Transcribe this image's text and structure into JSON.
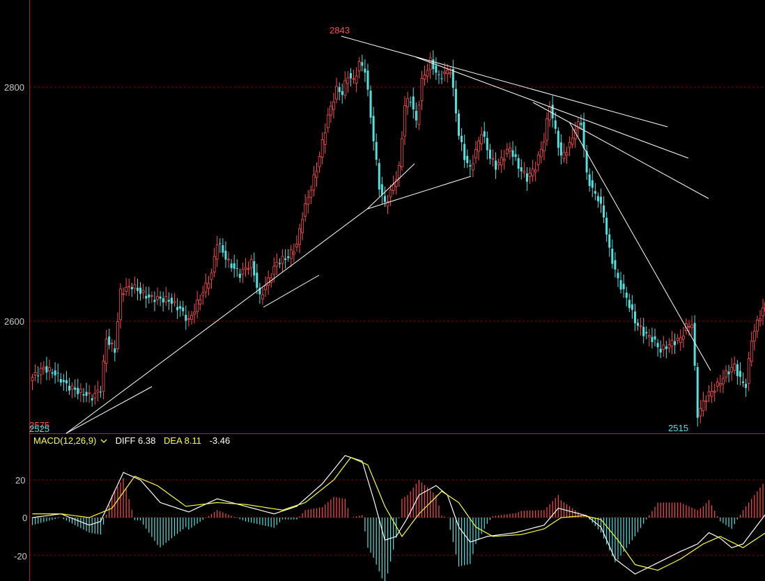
{
  "colors": {
    "background": "#000000",
    "up": "#ff4d4d",
    "down": "#4fe3e3",
    "grid": "#8b0000",
    "axis": "#b22222",
    "diff_line": "#ffffff",
    "dea_line": "#ffff33",
    "trendline": "#ffffff"
  },
  "price_panel": {
    "y_ticks": [
      "2800",
      "2600"
    ],
    "y_values": [
      2800,
      2600
    ],
    "ylim": [
      2510,
      2850
    ],
    "high_label": "2843",
    "low_label": "2515",
    "left_low_label": "2525",
    "left_overlap_label": "2575"
  },
  "macd_panel": {
    "legend": {
      "name": "MACD(12,26,9)",
      "dropdown_icon": "chevron-down-icon",
      "diff": "DIFF 6.38",
      "dea": "DEA 8.11",
      "macd": "-3.46"
    },
    "y_ticks": [
      "20",
      "0",
      "-20"
    ],
    "y_values": [
      20,
      0,
      -20
    ],
    "ylim": [
      -32,
      36
    ]
  },
  "chart_data": [
    {
      "type": "candlestick",
      "ylim": [
        2510,
        2850
      ],
      "close_anchors": [
        [
          0,
          2552
        ],
        [
          4,
          2560
        ],
        [
          8,
          2555
        ],
        [
          12,
          2545
        ],
        [
          16,
          2540
        ],
        [
          21,
          2535
        ],
        [
          24,
          2542
        ],
        [
          26,
          2585
        ],
        [
          29,
          2575
        ],
        [
          31,
          2625
        ],
        [
          35,
          2630
        ],
        [
          41,
          2620
        ],
        [
          48,
          2618
        ],
        [
          52,
          2610
        ],
        [
          55,
          2600
        ],
        [
          58,
          2615
        ],
        [
          63,
          2640
        ],
        [
          65,
          2668
        ],
        [
          69,
          2650
        ],
        [
          73,
          2640
        ],
        [
          77,
          2650
        ],
        [
          80,
          2620
        ],
        [
          83,
          2635
        ],
        [
          86,
          2650
        ],
        [
          90,
          2655
        ],
        [
          93,
          2665
        ],
        [
          95,
          2690
        ],
        [
          100,
          2730
        ],
        [
          104,
          2775
        ],
        [
          107,
          2798
        ],
        [
          109,
          2795
        ],
        [
          111,
          2810
        ],
        [
          113,
          2805
        ],
        [
          115,
          2820
        ],
        [
          117,
          2815
        ],
        [
          120,
          2755
        ],
        [
          122,
          2715
        ],
        [
          124,
          2700
        ],
        [
          126,
          2710
        ],
        [
          129,
          2730
        ],
        [
          131,
          2785
        ],
        [
          133,
          2790
        ],
        [
          135,
          2770
        ],
        [
          137,
          2805
        ],
        [
          140,
          2822
        ],
        [
          143,
          2808
        ],
        [
          147,
          2815
        ],
        [
          150,
          2760
        ],
        [
          152,
          2740
        ],
        [
          154,
          2730
        ],
        [
          156,
          2745
        ],
        [
          158,
          2762
        ],
        [
          161,
          2740
        ],
        [
          163,
          2732
        ],
        [
          165,
          2738
        ],
        [
          168,
          2748
        ],
        [
          171,
          2732
        ],
        [
          174,
          2722
        ],
        [
          177,
          2732
        ],
        [
          180,
          2755
        ],
        [
          182,
          2785
        ],
        [
          184,
          2762
        ],
        [
          186,
          2740
        ],
        [
          189,
          2750
        ],
        [
          191,
          2765
        ],
        [
          193,
          2770
        ],
        [
          195,
          2725
        ],
        [
          197,
          2712
        ],
        [
          199,
          2705
        ],
        [
          201,
          2690
        ],
        [
          203,
          2660
        ],
        [
          206,
          2635
        ],
        [
          209,
          2620
        ],
        [
          212,
          2600
        ],
        [
          215,
          2590
        ],
        [
          218,
          2585
        ],
        [
          221,
          2575
        ],
        [
          224,
          2580
        ],
        [
          228,
          2585
        ],
        [
          230,
          2595
        ],
        [
          232,
          2598
        ],
        [
          234,
          2520
        ],
        [
          237,
          2535
        ],
        [
          241,
          2545
        ],
        [
          244,
          2555
        ],
        [
          247,
          2562
        ],
        [
          249,
          2550
        ],
        [
          251,
          2545
        ],
        [
          253,
          2585
        ],
        [
          256,
          2605
        ],
        [
          259,
          2620
        ],
        [
          262,
          2610
        ],
        [
          264,
          2632
        ],
        [
          266,
          2622
        ]
      ]
    },
    {
      "type": "line",
      "name": "DIFF",
      "anchors": [
        [
          0,
          0
        ],
        [
          10,
          2
        ],
        [
          20,
          -4
        ],
        [
          24,
          -2
        ],
        [
          32,
          24
        ],
        [
          38,
          20
        ],
        [
          45,
          8
        ],
        [
          55,
          3
        ],
        [
          65,
          10
        ],
        [
          75,
          6
        ],
        [
          85,
          2
        ],
        [
          93,
          6
        ],
        [
          102,
          18
        ],
        [
          110,
          33
        ],
        [
          116,
          30
        ],
        [
          120,
          10
        ],
        [
          124,
          -12
        ],
        [
          128,
          -10
        ],
        [
          132,
          0
        ],
        [
          136,
          12
        ],
        [
          142,
          17
        ],
        [
          146,
          12
        ],
        [
          150,
          -5
        ],
        [
          154,
          -13
        ],
        [
          160,
          -10
        ],
        [
          170,
          -8
        ],
        [
          180,
          -4
        ],
        [
          185,
          5
        ],
        [
          190,
          3
        ],
        [
          195,
          1
        ],
        [
          200,
          -5
        ],
        [
          205,
          -22
        ],
        [
          212,
          -30
        ],
        [
          220,
          -24
        ],
        [
          228,
          -18
        ],
        [
          234,
          -14
        ],
        [
          238,
          -8
        ],
        [
          242,
          -11
        ],
        [
          246,
          -16
        ],
        [
          250,
          -14
        ],
        [
          256,
          -2
        ],
        [
          262,
          10
        ],
        [
          268,
          18
        ]
      ]
    },
    {
      "type": "line",
      "name": "DEA",
      "anchors": [
        [
          0,
          2
        ],
        [
          10,
          2
        ],
        [
          20,
          0
        ],
        [
          28,
          5
        ],
        [
          36,
          22
        ],
        [
          44,
          17
        ],
        [
          54,
          6
        ],
        [
          65,
          8
        ],
        [
          75,
          7
        ],
        [
          88,
          4
        ],
        [
          96,
          8
        ],
        [
          106,
          20
        ],
        [
          112,
          32
        ],
        [
          118,
          28
        ],
        [
          124,
          6
        ],
        [
          130,
          -10
        ],
        [
          136,
          2
        ],
        [
          144,
          14
        ],
        [
          150,
          8
        ],
        [
          156,
          -5
        ],
        [
          162,
          -10
        ],
        [
          172,
          -9
        ],
        [
          180,
          -6
        ],
        [
          186,
          0
        ],
        [
          194,
          1
        ],
        [
          200,
          -1
        ],
        [
          206,
          -12
        ],
        [
          212,
          -25
        ],
        [
          220,
          -28
        ],
        [
          228,
          -22
        ],
        [
          236,
          -14
        ],
        [
          242,
          -10
        ],
        [
          250,
          -16
        ],
        [
          258,
          -8
        ],
        [
          266,
          10
        ],
        [
          270,
          17
        ]
      ]
    },
    {
      "type": "bar",
      "name": "MACD",
      "derived_from": "2 * (DIFF - DEA)",
      "last_value": -3.46
    }
  ]
}
